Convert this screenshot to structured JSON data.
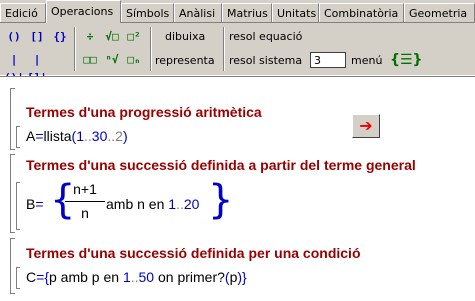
{
  "tabs": [
    "Edició",
    "Operacions",
    "Símbols",
    "Anàlisi",
    "Matrius",
    "Unitats",
    "Combinatòria",
    "Geometria"
  ],
  "active_tab": "Operacions",
  "toolbar": {
    "icons_row1": [
      "()",
      "[]",
      "{}"
    ],
    "icons_row2": [
      "|()|",
      "|[]|"
    ],
    "label_dibuixa": "dibuixa",
    "label_representa": "representa",
    "label_resol_equacio": "resol equació",
    "label_resol_sistema": "resol sistema",
    "system_count": "3",
    "label_menu": "menú"
  },
  "blocks": [
    {
      "heading": "Termes d'una progressió aritmètica",
      "expr_var": "A",
      "expr_eq": "=",
      "expr_func": "llista",
      "expr_args_open": "(",
      "expr_arg1": "1",
      "expr_range": "..",
      "expr_arg2": "30",
      "expr_arg3": "..2",
      "expr_args_close": ")"
    },
    {
      "heading": "Termes d'una successió definida a partir del terme general",
      "expr_var": "B",
      "expr_eq": "=",
      "numerator": "n+1",
      "denominator": "n",
      "tail_amb": "amb n en ",
      "range_start": "1",
      "range_dots": "..",
      "range_end": "20"
    },
    {
      "heading": "Termes d'una successió definida per una condició",
      "expr_var": "C",
      "expr_eq": "=",
      "open_brace": "{",
      "text1": "p amb p en ",
      "range_start": "1",
      "range_dots": "..",
      "range_end": "50",
      "text2": " on primer?",
      "paren_open": "(",
      "param": "p",
      "paren_close": ")",
      "close_brace": "}"
    }
  ],
  "run_button_symbol": "➔"
}
